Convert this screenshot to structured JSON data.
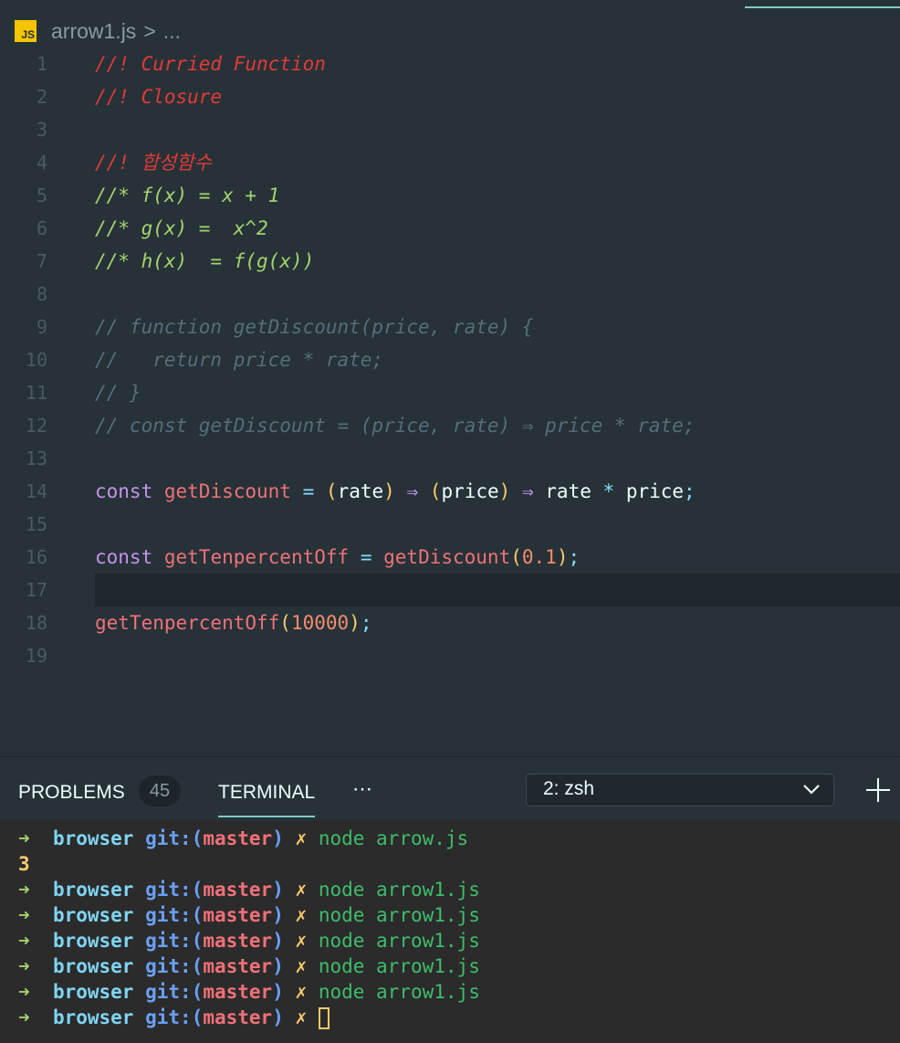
{
  "breadcrumb": {
    "file": "arrow1.js",
    "icon_label": "JS",
    "more": "..."
  },
  "editor": {
    "lines": [
      {
        "n": "1"
      },
      {
        "n": "2"
      },
      {
        "n": "3"
      },
      {
        "n": "4"
      },
      {
        "n": "5"
      },
      {
        "n": "6"
      },
      {
        "n": "7"
      },
      {
        "n": "8"
      },
      {
        "n": "9"
      },
      {
        "n": "10"
      },
      {
        "n": "11"
      },
      {
        "n": "12"
      },
      {
        "n": "13"
      },
      {
        "n": "14"
      },
      {
        "n": "15"
      },
      {
        "n": "16"
      },
      {
        "n": "17"
      },
      {
        "n": "18"
      },
      {
        "n": "19"
      }
    ],
    "code": {
      "l1": "//! Curried Function",
      "l2": "//! Closure",
      "l4": "//! 합성함수",
      "l5": "//* f(x) = x + 1",
      "l6": "//* g(x) =  x^2",
      "l7": "//* h(x)  = f(g(x))",
      "l9": "// function getDiscount(price, rate) {",
      "l10": "//   return price * rate;",
      "l11": "// }",
      "l12": "// const getDiscount = (price, rate) ⇒ price * rate;",
      "kw_const": "const",
      "getDiscount": "getDiscount",
      "eq": "=",
      "lp": "(",
      "rp": ")",
      "rate": "rate",
      "price": "price",
      "arrow": "⇒",
      "star": "*",
      "semi": ";",
      "getTenpercentOff": "getTenpercentOff",
      "num01": "0.1",
      "num10000": "10000"
    },
    "current_line": "17"
  },
  "panel": {
    "tabs": {
      "problems": "PROBLEMS",
      "problems_count": "45",
      "terminal": "TERMINAL",
      "more": "⋯"
    },
    "terminal_select": "2: zsh",
    "terminal_lines": [
      {
        "arrow": "➜",
        "dir": "browser",
        "git": "git:(",
        "branch": "master",
        "git_close": ")",
        "x": "✗",
        "cmd": "node arrow.js"
      },
      {
        "output": "3"
      },
      {
        "arrow": "➜",
        "dir": "browser",
        "git": "git:(",
        "branch": "master",
        "git_close": ")",
        "x": "✗",
        "cmd": "node arrow1.js"
      },
      {
        "arrow": "➜",
        "dir": "browser",
        "git": "git:(",
        "branch": "master",
        "git_close": ")",
        "x": "✗",
        "cmd": "node arrow1.js"
      },
      {
        "arrow": "➜",
        "dir": "browser",
        "git": "git:(",
        "branch": "master",
        "git_close": ")",
        "x": "✗",
        "cmd": "node arrow1.js"
      },
      {
        "arrow": "➜",
        "dir": "browser",
        "git": "git:(",
        "branch": "master",
        "git_close": ")",
        "x": "✗",
        "cmd": "node arrow1.js"
      },
      {
        "arrow": "➜",
        "dir": "browser",
        "git": "git:(",
        "branch": "master",
        "git_close": ")",
        "x": "✗",
        "cmd": "node arrow1.js"
      },
      {
        "arrow": "➜",
        "dir": "browser",
        "git": "git:(",
        "branch": "master",
        "git_close": ")",
        "x": "✗",
        "cmd": ""
      }
    ]
  },
  "colors": {
    "editor_bg": "#263238",
    "terminal_bg": "#2b2b2b",
    "accent": "#80cbc4"
  }
}
